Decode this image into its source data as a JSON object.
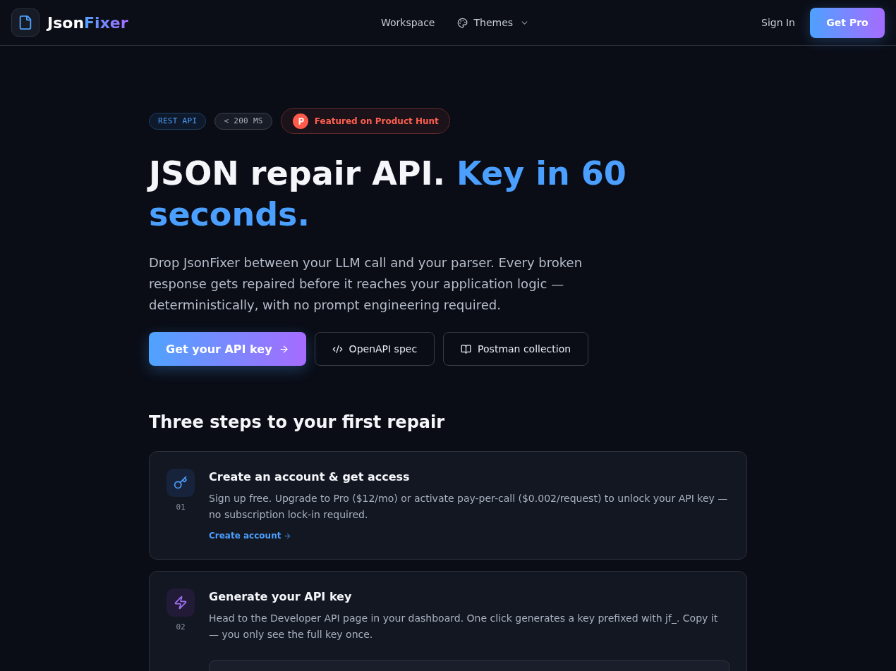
{
  "header": {
    "logo": {
      "text": "Json",
      "accent": "Fixer"
    },
    "nav": [
      {
        "label": "Workspace",
        "dropdown": false
      },
      {
        "label": "Themes",
        "dropdown": true
      }
    ],
    "sign_in": "Sign In",
    "cta": "Get Pro"
  },
  "hero": {
    "badges": [
      {
        "label": "REST API",
        "kind": "accent"
      },
      {
        "label": "< 200 MS",
        "kind": "muted"
      },
      {
        "label": "Featured on Product Hunt",
        "kind": "featured"
      }
    ],
    "title": "JSON repair API.",
    "title_accent": "Key in 60 seconds.",
    "description": "Drop JsonFixer between your LLM call and your parser. Every broken response gets repaired before it reaches your application logic — deterministically, with no prompt engineering required.",
    "buttons": [
      {
        "label": "Get your API key",
        "kind": "primary"
      },
      {
        "label": "OpenAPI spec",
        "kind": "secondary"
      },
      {
        "label": "Postman collection",
        "kind": "secondary"
      }
    ]
  },
  "steps": {
    "heading": "Three steps to your first repair",
    "items": [
      {
        "number": "01",
        "title": "Create an account & get access",
        "description": "Sign up free. Upgrade to Pro ($12/mo) or activate pay-per-call ($0.002/request) to unlock your API key — no subscription lock-in required.",
        "link": "Create account",
        "preview_window": false
      },
      {
        "number": "02",
        "title": "Generate your API key",
        "description": "Head to the Developer API page in your dashboard. One click generates a key prefixed with jf_. Copy it — you only see the full key once.",
        "preview_window": true
      }
    ]
  }
}
